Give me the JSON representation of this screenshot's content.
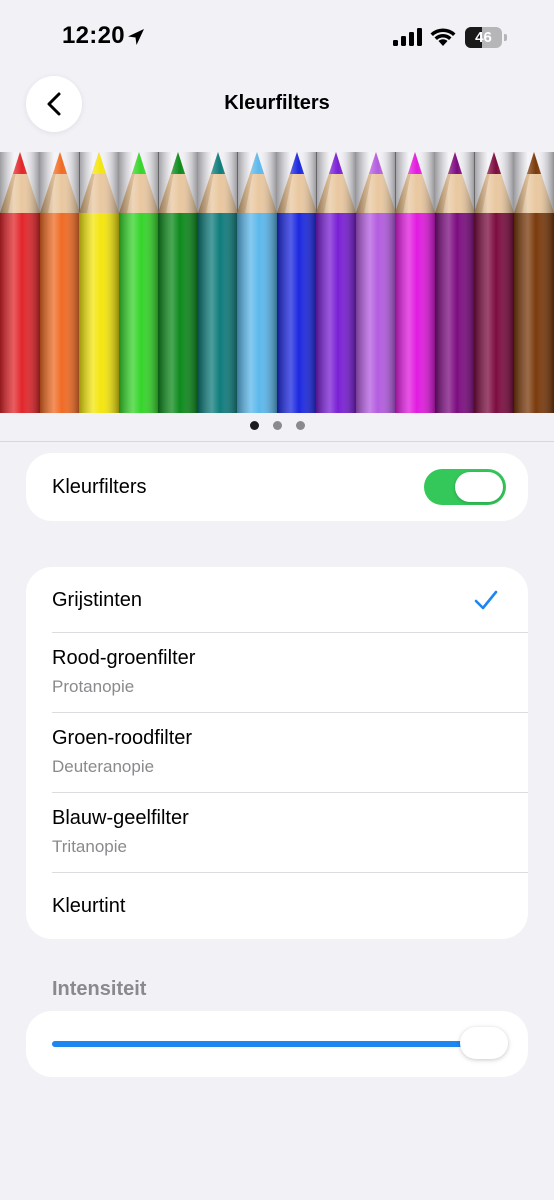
{
  "status_bar": {
    "time": "12:20",
    "battery": "46",
    "battery_level": 0.46
  },
  "nav": {
    "title": "Kleurfilters",
    "back_icon": "chevron-left-icon"
  },
  "banner": {
    "pencil_colors": [
      "#e2262b",
      "#f06b24",
      "#f4e60e",
      "#35d52a",
      "#0d8a1c",
      "#0f7c7c",
      "#5cb8ec",
      "#1c28e0",
      "#7a1fd6",
      "#b45ce0",
      "#e21be0",
      "#7c0c80",
      "#7c0c40",
      "#7a3a0c"
    ],
    "pages": 3,
    "active_page": 0
  },
  "toggle": {
    "label": "Kleurfilters",
    "on": true,
    "color": "#34c759"
  },
  "filters": [
    {
      "title": "Grijstinten",
      "subtitle": "",
      "selected": true
    },
    {
      "title": "Rood-groenfilter",
      "subtitle": "Protanopie",
      "selected": false
    },
    {
      "title": "Groen-roodfilter",
      "subtitle": "Deuteranopie",
      "selected": false
    },
    {
      "title": "Blauw-geelfilter",
      "subtitle": "Tritanopie",
      "selected": false
    },
    {
      "title": "Kleurtint",
      "subtitle": "",
      "selected": false
    }
  ],
  "intensity": {
    "label": "Intensiteit",
    "value": 1.0,
    "accent": "#1e86f0"
  }
}
